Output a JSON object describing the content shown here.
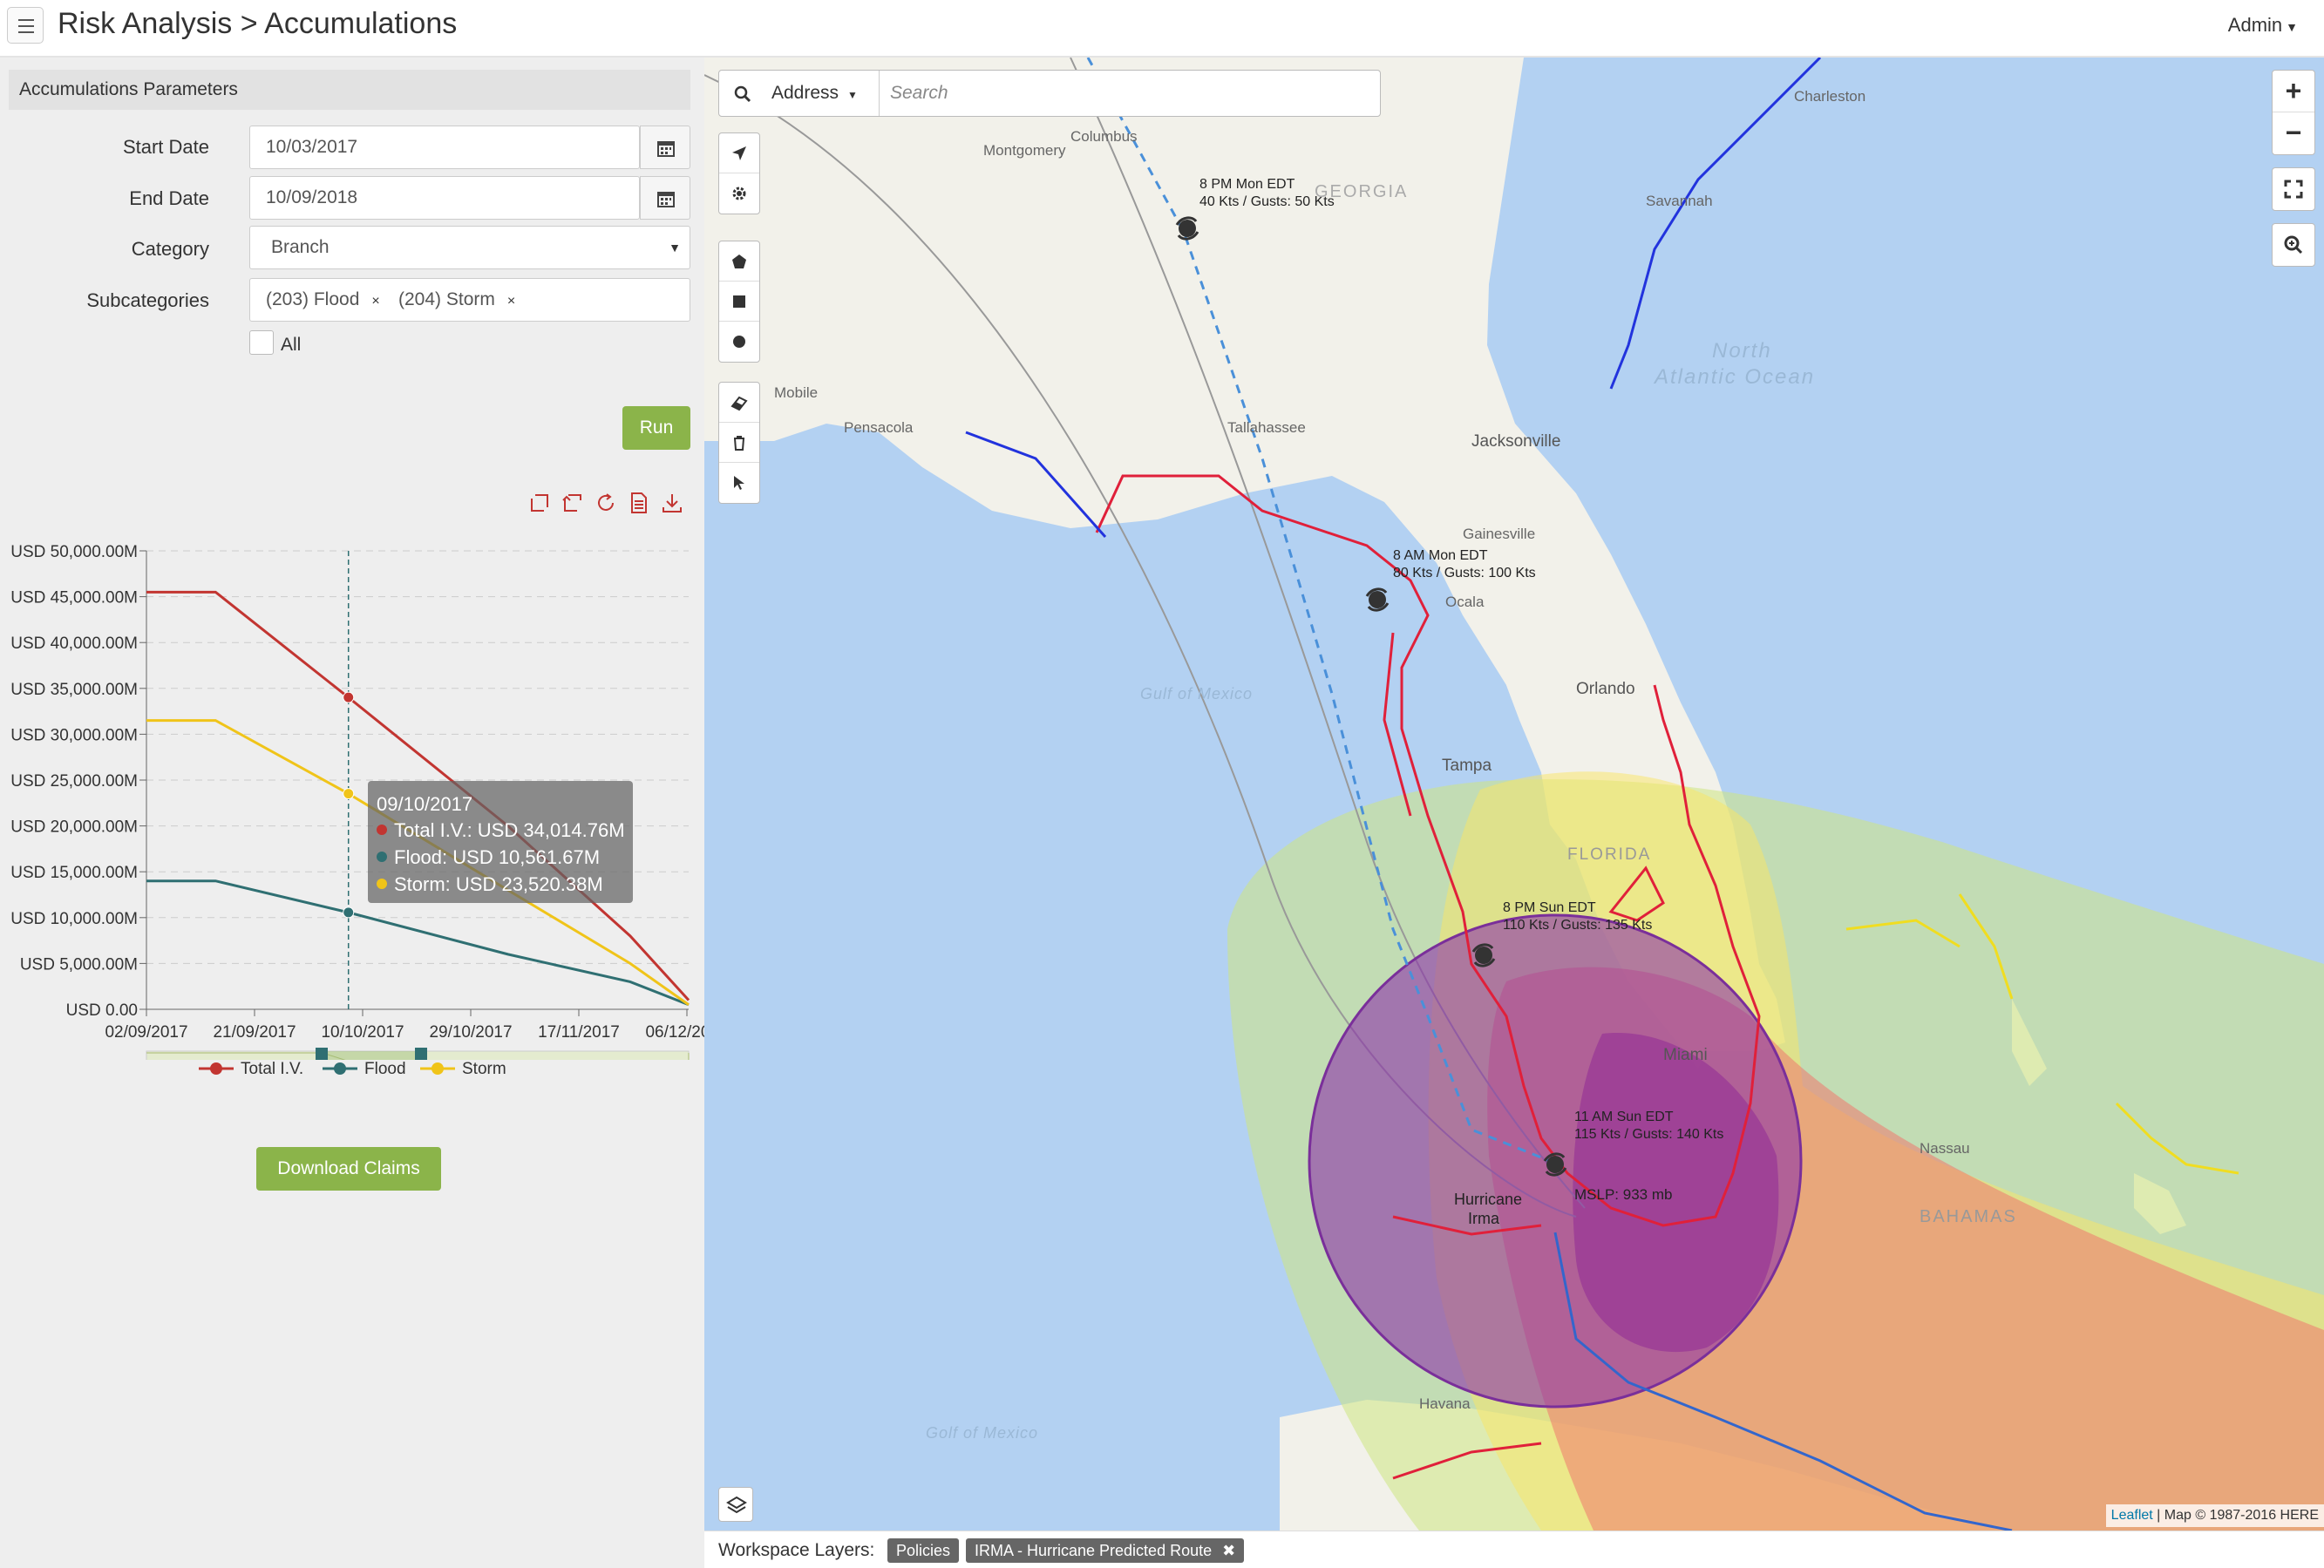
{
  "header": {
    "title": "Risk Analysis > Accumulations",
    "user_menu": "Admin"
  },
  "params": {
    "section_title": "Accumulations Parameters",
    "start_date_label": "Start Date",
    "start_date_value": "10/03/2017",
    "end_date_label": "End Date",
    "end_date_value": "10/09/2018",
    "category_label": "Category",
    "category_value": "Branch",
    "subcategories_label": "Subcategories",
    "subcategories": [
      "(203) Flood",
      "(204) Storm"
    ],
    "all_label": "All",
    "all_checked": false,
    "run_label": "Run"
  },
  "chart_toolbar_icons": [
    "zoom-icon",
    "zoom-reset-icon",
    "restore-icon",
    "save-as-data-icon",
    "save-as-image-icon"
  ],
  "chart_data": {
    "type": "line",
    "y_ticks": [
      "USD 50,000.00M",
      "USD 45,000.00M",
      "USD 40,000.00M",
      "USD 35,000.00M",
      "USD 30,000.00M",
      "USD 25,000.00M",
      "USD 20,000.00M",
      "USD 15,000.00M",
      "USD 10,000.00M",
      "USD 5,000.00M",
      "USD 0.00"
    ],
    "x_ticks": [
      "02/09/2017",
      "21/09/2017",
      "10/10/2017",
      "29/10/2017",
      "17/11/2017",
      "06/12/2017"
    ],
    "ylim": [
      0,
      50000
    ],
    "x_start": "2017-09-02",
    "x_end": "2017-12-13",
    "series": [
      {
        "name": "Total I.V.",
        "color": "#c23531",
        "points": [
          [
            "2017-09-02",
            45500
          ],
          [
            "2017-09-15",
            45500
          ],
          [
            "2017-10-10",
            34014.76
          ],
          [
            "2017-11-09",
            20000
          ],
          [
            "2017-12-02",
            8000
          ],
          [
            "2017-12-13",
            1000
          ]
        ]
      },
      {
        "name": "Flood",
        "color": "#2f6f72",
        "points": [
          [
            "2017-09-02",
            14000
          ],
          [
            "2017-09-15",
            14000
          ],
          [
            "2017-10-10",
            10561.67
          ],
          [
            "2017-11-09",
            6000
          ],
          [
            "2017-12-02",
            3000
          ],
          [
            "2017-12-13",
            500
          ]
        ]
      },
      {
        "name": "Storm",
        "color": "#f0c419",
        "points": [
          [
            "2017-09-02",
            31500
          ],
          [
            "2017-09-15",
            31500
          ],
          [
            "2017-10-10",
            23520.38
          ],
          [
            "2017-11-09",
            13000
          ],
          [
            "2017-12-02",
            5000
          ],
          [
            "2017-12-13",
            500
          ]
        ]
      }
    ],
    "tooltip": {
      "date": "09/10/2017",
      "lines": [
        "Total I.V.: USD 34,014.76M",
        "Flood: USD 10,561.67M",
        "Storm: USD 23,520.38M"
      ]
    },
    "grid": true,
    "legend_position": "bottom"
  },
  "download_claims_label": "Download Claims",
  "map": {
    "search": {
      "mode_label": "Address",
      "placeholder": "Search"
    },
    "draw_tools": [
      "locate-icon",
      "settings-icon",
      "polygon-icon",
      "rectangle-icon",
      "circle-icon",
      "eraser-icon",
      "trash-icon",
      "pointer-icon"
    ],
    "zoom_in": "+",
    "zoom_out": "−",
    "attribution_link": "Leaflet",
    "attribution_text": "| Map © 1987-2016 HERE",
    "place_labels": {
      "montgomery": "Montgomery",
      "georgia": "GEORGIA",
      "savannah": "Savannah",
      "mobile": "Mobile",
      "pensacola": "Pensacola",
      "tallahassee": "Tallahassee",
      "jacksonville": "Jacksonville",
      "north_atlantic": "North",
      "north_atlantic2": "Atlantic Ocean",
      "gulf_mexico": "Gulf of Mexico",
      "gulf_mexico2": "Golf of Mexico",
      "orlando": "Orlando",
      "tampa": "Tampa",
      "florida": "FLORIDA",
      "miami": "Miami",
      "bahamas": "BAHAMAS",
      "nassau": "Nassau",
      "havana": "Havana",
      "ocala": "Ocala",
      "gainesville": "Gainesville",
      "columbus": "Columbus",
      "charleston": "Charleston"
    },
    "storm_labels": {
      "p1_line1": "8 PM Mon EDT",
      "p1_line2": "40 Kts / Gusts: 50 Kts",
      "p2_line1": "8 AM Mon EDT",
      "p2_line2": "80 Kts / Gusts: 100 Kts",
      "p3_line1": "8 PM Sun EDT",
      "p3_line2": "110 Kts / Gusts: 135 Kts",
      "p4_line1": "11 AM Sun EDT",
      "p4_line2": "115 Kts / Gusts: 140 Kts",
      "name_line1": "Hurricane",
      "name_line2": "Irma",
      "mslp": "MSLP: 933 mb"
    }
  },
  "workspace": {
    "label": "Workspace Layers:",
    "layers": [
      "Policies",
      "IRMA - Hurricane Predicted Route"
    ]
  }
}
